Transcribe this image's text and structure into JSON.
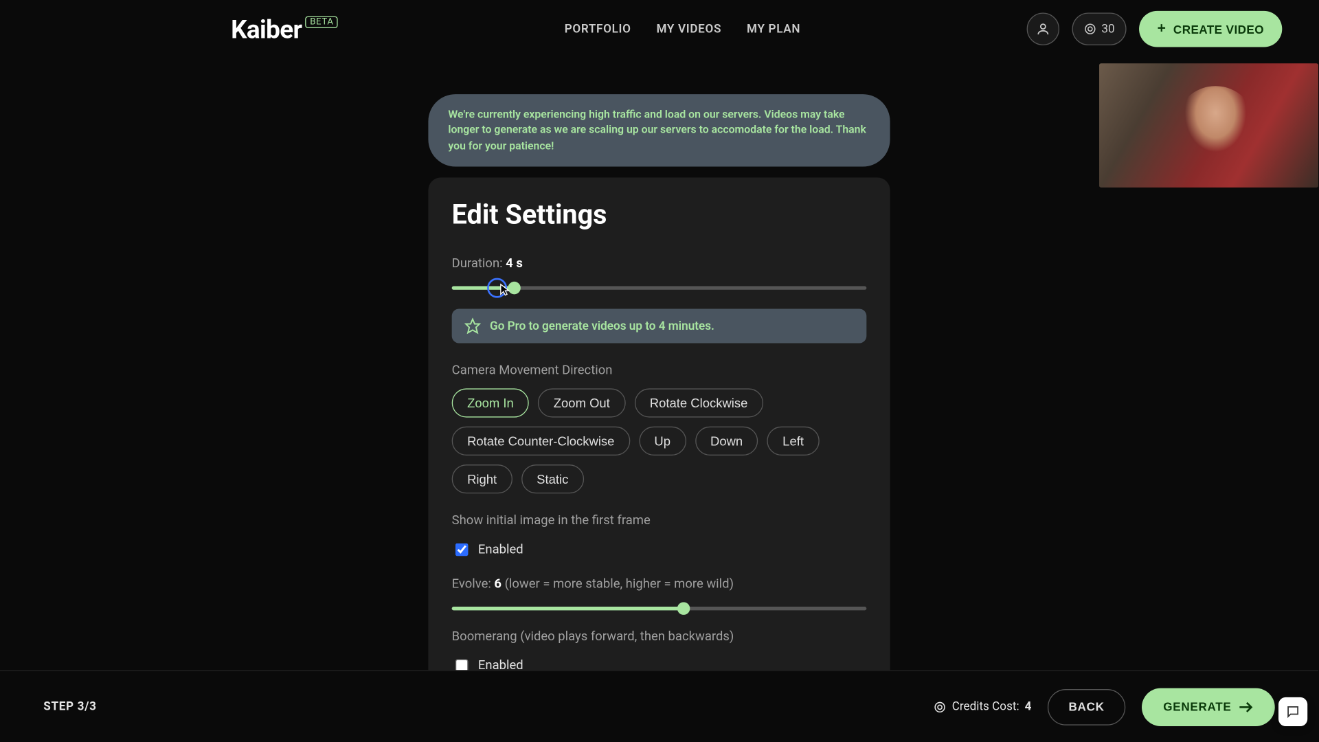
{
  "header": {
    "logo": "Kaiber",
    "beta": "BETA",
    "nav": {
      "portfolio": "PORTFOLIO",
      "myvideos": "MY VIDEOS",
      "myplan": "MY PLAN"
    },
    "credits": "30",
    "create": "CREATE VIDEO"
  },
  "notice": "We're currently experiencing high traffic and load on our servers. Videos may take longer to generate as we are scaling up our servers to accomodate for the load. Thank you for your patience!",
  "card": {
    "title": "Edit Settings",
    "duration": {
      "label": "Duration: ",
      "value": "4 s",
      "percent": 15
    },
    "pro_banner": "Go Pro to generate videos up to 4 minutes.",
    "camera": {
      "label": "Camera Movement Direction",
      "options": [
        "Zoom In",
        "Zoom Out",
        "Rotate Clockwise",
        "Rotate Counter-Clockwise",
        "Up",
        "Down",
        "Left",
        "Right",
        "Static"
      ],
      "selected": "Zoom In"
    },
    "show_initial": {
      "label": "Show initial image in the first frame",
      "enabled_label": "Enabled",
      "checked": true
    },
    "evolve": {
      "label_pre": "Evolve: ",
      "value": "6",
      "label_post": " (lower = more stable, higher = more wild)",
      "percent": 56
    },
    "boomerang": {
      "label": "Boomerang (video plays forward, then backwards)",
      "enabled_label": "Enabled",
      "checked": false
    }
  },
  "footer": {
    "step": "STEP 3/3",
    "credits_label": "Credits Cost: ",
    "credits_value": "4",
    "back": "BACK",
    "generate": "GENERATE"
  }
}
